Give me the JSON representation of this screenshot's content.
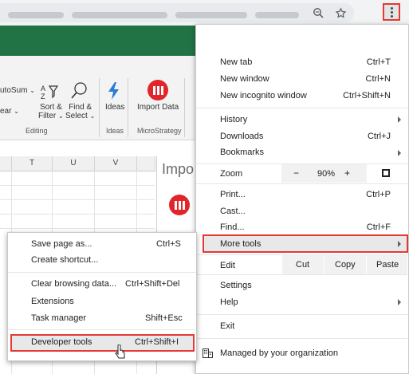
{
  "browser": {
    "menu_icon": "kebab-menu-icon",
    "zoom_icon": "zoom-icon",
    "bookmark_icon": "star-icon"
  },
  "excel": {
    "ribbon": {
      "autosum_label": "utoSum",
      "clear_label": "ear",
      "sort_label_1": "Sort &",
      "sort_label_2": "Filter",
      "find_label_1": "Find &",
      "find_label_2": "Select",
      "ideas_label": "Ideas",
      "import_label": "Import Data",
      "group_editing": "Editing",
      "group_ideas": "Ideas",
      "group_microstrategy": "MicroStrategy"
    },
    "columns": [
      "T",
      "U",
      "V"
    ],
    "panel_title": "Impo"
  },
  "menu": {
    "new_tab": {
      "label": "New tab",
      "shortcut": "Ctrl+T"
    },
    "new_window": {
      "label": "New window",
      "shortcut": "Ctrl+N"
    },
    "new_incognito": {
      "label": "New incognito window",
      "shortcut": "Ctrl+Shift+N"
    },
    "history": {
      "label": "History"
    },
    "downloads": {
      "label": "Downloads",
      "shortcut": "Ctrl+J"
    },
    "bookmarks": {
      "label": "Bookmarks"
    },
    "zoom": {
      "label": "Zoom",
      "minus": "−",
      "value": "90%",
      "plus": "+"
    },
    "print": {
      "label": "Print...",
      "shortcut": "Ctrl+P"
    },
    "cast": {
      "label": "Cast..."
    },
    "find": {
      "label": "Find...",
      "shortcut": "Ctrl+F"
    },
    "more_tools": {
      "label": "More tools"
    },
    "edit": {
      "label": "Edit",
      "cut": "Cut",
      "copy": "Copy",
      "paste": "Paste"
    },
    "settings": {
      "label": "Settings"
    },
    "help": {
      "label": "Help"
    },
    "exit": {
      "label": "Exit"
    },
    "managed": {
      "label": "Managed by your organization"
    }
  },
  "submenu": {
    "save_page": {
      "label": "Save page as...",
      "shortcut": "Ctrl+S"
    },
    "create_shortcut": {
      "label": "Create shortcut..."
    },
    "clear_data": {
      "label": "Clear browsing data...",
      "shortcut": "Ctrl+Shift+Del"
    },
    "extensions": {
      "label": "Extensions"
    },
    "task_manager": {
      "label": "Task manager",
      "shortcut": "Shift+Esc"
    },
    "dev_tools": {
      "label": "Developer tools",
      "shortcut": "Ctrl+Shift+I"
    }
  },
  "colors": {
    "highlight_border": "#e53935",
    "excel_green": "#217346",
    "microstrategy_red": "#e0262a",
    "ideas_blue": "#2b7cd3"
  }
}
